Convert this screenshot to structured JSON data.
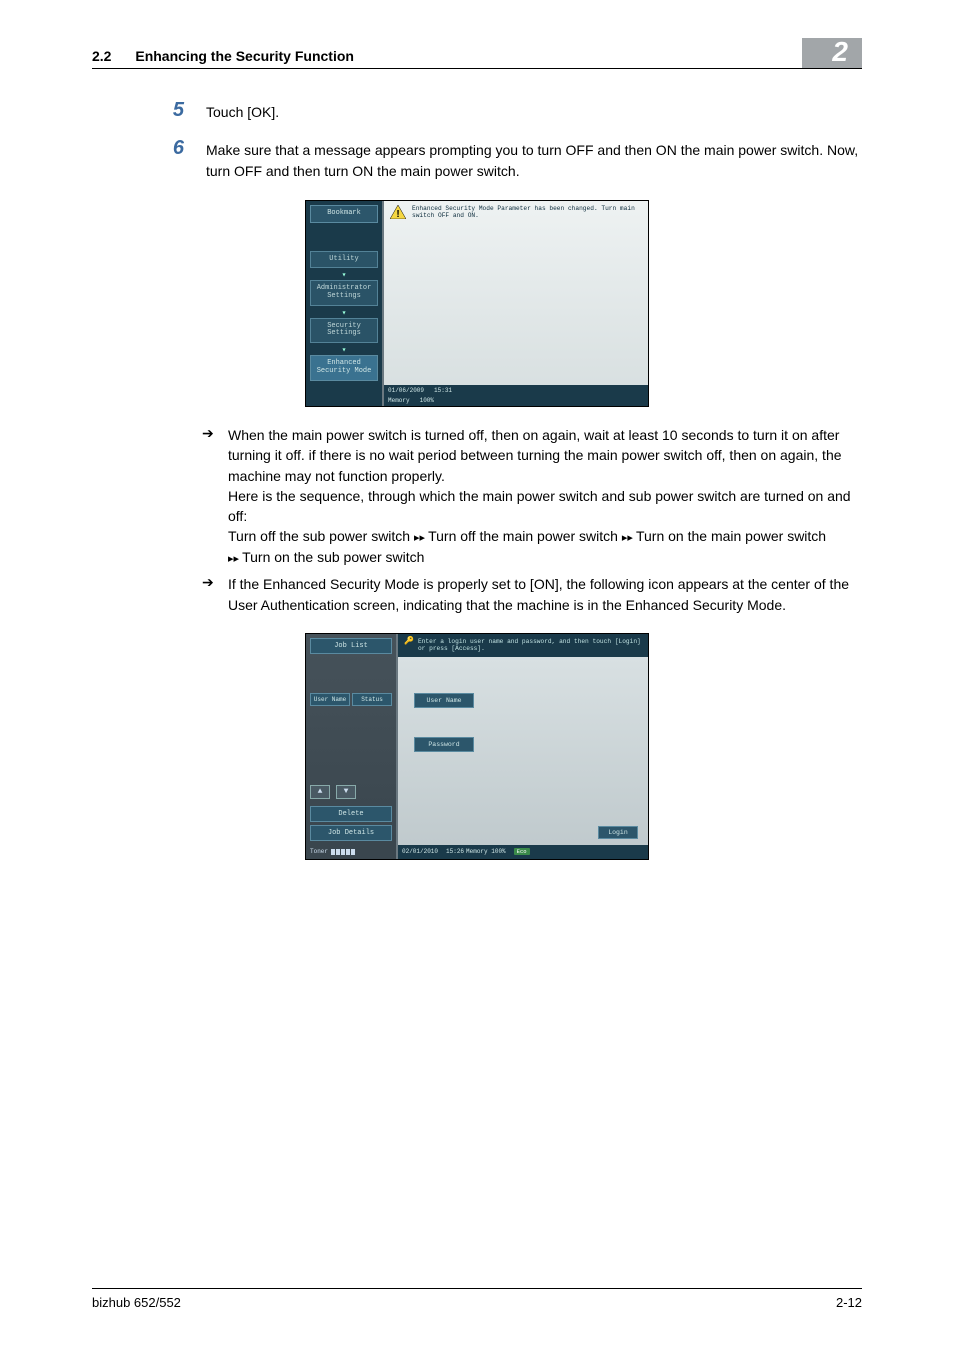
{
  "header": {
    "section_num": "2.2",
    "section_title": "Enhancing the Security Function",
    "chapter_num": "2"
  },
  "steps": {
    "s5": {
      "num": "5",
      "text": "Touch [OK]."
    },
    "s6": {
      "num": "6",
      "text": "Make sure that a message appears prompting you to turn OFF and then ON the main power switch. Now, turn OFF and then turn ON the main power switch."
    }
  },
  "scr1": {
    "left": {
      "bookmark": "Bookmark",
      "utility": "Utility",
      "admin": "Administrator Settings",
      "security": "Security Settings",
      "enhanced": "Enhanced Security Mode"
    },
    "msg": "Enhanced Security Mode Parameter has been changed. Turn main switch OFF and ON.",
    "status": {
      "date": "01/06/2009",
      "time": "15:31",
      "mem_label": "Memory",
      "mem_val": "100%"
    }
  },
  "bullets": {
    "b1": "When the main power switch is turned off, then on again, wait at least 10 seconds to turn it on after turning it off. if there is no wait period between turning the main power switch off, then on again, the machine may not function properly.",
    "b1b": "Here is the sequence, through which the main power switch and sub power switch are turned on and off:",
    "seq_a": "Turn off the sub power switch",
    "seq_b": "Turn off the main power switch",
    "seq_c": "Turn on the main power switch",
    "seq_d": "Turn on the sub power switch",
    "b2": "If the Enhanced Security Mode is properly set to [ON], the following icon appears at the center of the User Authentication screen, indicating that the machine is in the Enhanced Security Mode."
  },
  "scr2": {
    "left": {
      "joblist": "Job List",
      "col1": "User Name",
      "col2": "Status",
      "delete": "Delete",
      "details": "Job Details",
      "toner": "Toner"
    },
    "prompt": "Enter a login user name and password, and then touch [Login] or press [Access].",
    "user_label": "User Name",
    "pass_label": "Password",
    "login": "Login",
    "status": {
      "date": "02/01/2010",
      "time": "15:26",
      "mem_label": "Memory",
      "mem_val": "100%",
      "eco": "Eco"
    }
  },
  "footer": {
    "product": "bizhub 652/552",
    "page": "2-12"
  }
}
